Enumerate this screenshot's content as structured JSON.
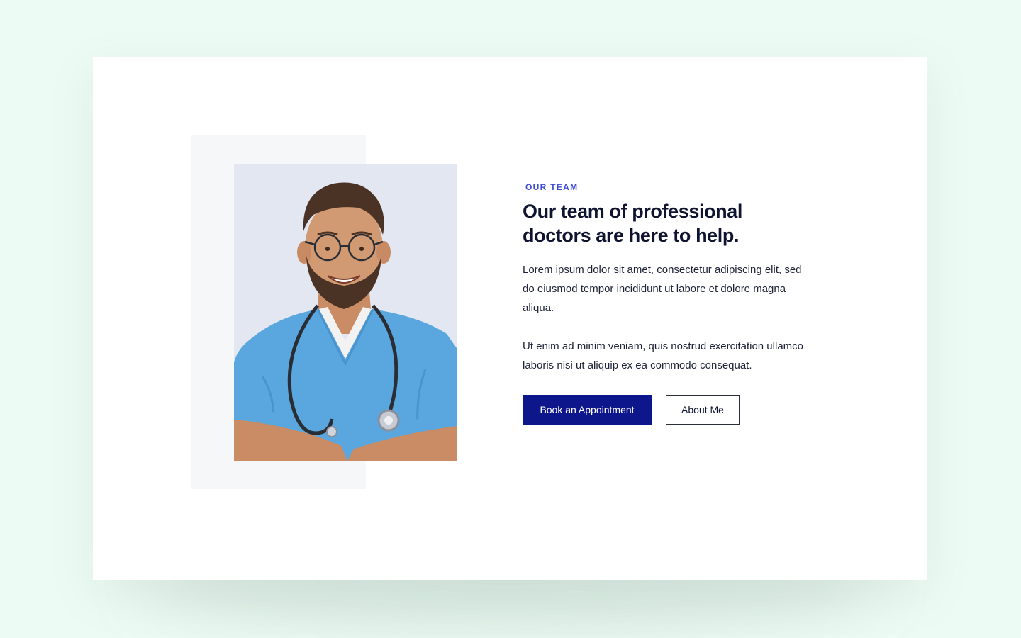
{
  "section": {
    "eyebrow": "OUR TEAM",
    "headline": "Our team of professional doctors are here to help.",
    "paragraphs": [
      "Lorem ipsum dolor sit amet, consectetur adipiscing elit, sed do eiusmod tempor incididunt ut labore et dolore magna aliqua.",
      "Ut enim ad minim veniam, quis nostrud exercitation ullamco laboris nisi ut aliquip ex ea commodo consequat."
    ],
    "buttons": {
      "primary_label": "Book an Appointment",
      "secondary_label": "About Me"
    }
  },
  "colors": {
    "page_background": "#ecfbf3",
    "accent": "#3f4dd6",
    "primary_button": "#0d168a",
    "heading": "#0e1430",
    "scrubs": "#5aa7e0"
  },
  "image": {
    "subject": "smiling doctor in blue scrubs with stethoscope"
  }
}
